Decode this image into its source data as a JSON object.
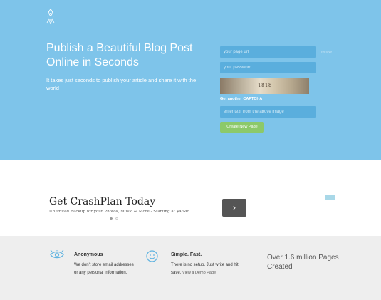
{
  "hero": {
    "title": "Publish a Beautiful Blog Post Online in Seconds",
    "subtitle": "It takes just seconds to publish your article and share it with the world"
  },
  "form": {
    "url_placeholder": "your page url",
    "url_hint": "remove",
    "password_placeholder": "your password",
    "captcha_text": "1818",
    "captcha_link": "Get another CAPTCHA",
    "captcha_placeholder": "enter text from the above image",
    "submit_label": "Create New Page"
  },
  "ad": {
    "title": "Get CrashPlan Today",
    "subtitle": "Unlimited Backup for your Photos, Music & More - Starting at $4/Mo.",
    "arrow": "›"
  },
  "features": [
    {
      "icon": "eye-icon",
      "title": "Anonymous",
      "text": "We don't store email addresses or any personal information."
    },
    {
      "icon": "smiley-icon",
      "title": "Simple. Fast.",
      "text": "There is no setup. Just write and hit save.",
      "link": "View a Demo Page"
    }
  ],
  "stat": "Over 1.6 million Pages Created",
  "colors": {
    "hero_bg": "#7ec4ea",
    "field_bg": "#5aaedd",
    "button_bg": "#8cc96a",
    "icon": "#5fb3e0"
  }
}
